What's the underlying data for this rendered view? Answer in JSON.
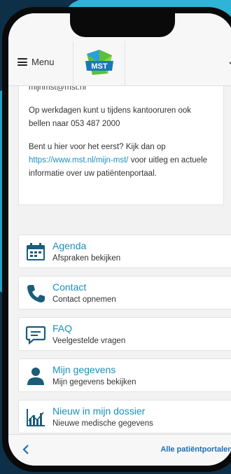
{
  "header": {
    "menu_label": "Menu",
    "logo_text": "MST"
  },
  "info": {
    "email_partial": "mijnmst@mst.nl",
    "phone_text": "Op werkdagen kunt u tijdens kantooruren ook bellen naar 053 487 2000",
    "first_time_text_before": "Bent u hier voor het eerst? Kijk dan op ",
    "link_text": "https://www.mst.nl/mijn-mst/",
    "first_time_text_after": " voor uitleg en actuele informatie over uw patiëntenportaal."
  },
  "items": [
    {
      "title": "Agenda",
      "subtitle": "Afspraken bekijken",
      "icon": "calendar-icon"
    },
    {
      "title": "Contact",
      "subtitle": "Contact opnemen",
      "icon": "phone-icon"
    },
    {
      "title": "FAQ",
      "subtitle": "Veelgestelde vragen",
      "icon": "chat-icon"
    },
    {
      "title": "Mijn gegevens",
      "subtitle": "Mijn gegevens bekijken",
      "icon": "person-icon"
    },
    {
      "title": "Nieuw in mijn dossier",
      "subtitle": "Nieuwe medische gegevens",
      "icon": "chart-icon"
    }
  ],
  "footer": {
    "portals_label": "Alle patiëntportalen"
  },
  "colors": {
    "accent": "#1b8fb8",
    "icon": "#1a5d7a",
    "background": "#0d3048"
  }
}
